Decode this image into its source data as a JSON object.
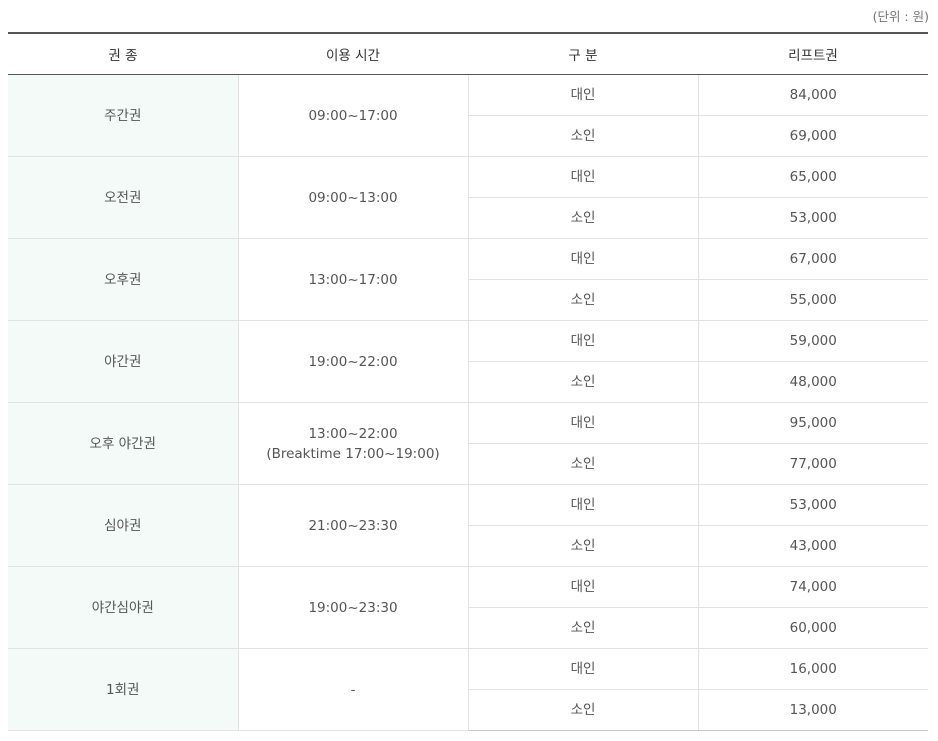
{
  "unit_note": "(단위 : 원)",
  "headers": [
    "권 종",
    "이용 시간",
    "구 분",
    "리프트권"
  ],
  "rows": [
    {
      "type": "주간권",
      "time": "09:00~17:00",
      "time2": "",
      "prices": [
        {
          "label": "대인",
          "price": "84,000"
        },
        {
          "label": "소인",
          "price": "69,000"
        }
      ]
    },
    {
      "type": "오전권",
      "time": "09:00~13:00",
      "time2": "",
      "prices": [
        {
          "label": "대인",
          "price": "65,000"
        },
        {
          "label": "소인",
          "price": "53,000"
        }
      ]
    },
    {
      "type": "오후권",
      "time": "13:00~17:00",
      "time2": "",
      "prices": [
        {
          "label": "대인",
          "price": "67,000"
        },
        {
          "label": "소인",
          "price": "55,000"
        }
      ]
    },
    {
      "type": "야간권",
      "time": "19:00~22:00",
      "time2": "",
      "prices": [
        {
          "label": "대인",
          "price": "59,000"
        },
        {
          "label": "소인",
          "price": "48,000"
        }
      ]
    },
    {
      "type": "오후 야간권",
      "time": "13:00~22:00",
      "time2": "(Breaktime 17:00~19:00)",
      "prices": [
        {
          "label": "대인",
          "price": "95,000"
        },
        {
          "label": "소인",
          "price": "77,000"
        }
      ]
    },
    {
      "type": "심야권",
      "time": "21:00~23:30",
      "time2": "",
      "prices": [
        {
          "label": "대인",
          "price": "53,000"
        },
        {
          "label": "소인",
          "price": "43,000"
        }
      ]
    },
    {
      "type": "야간심야권",
      "time": "19:00~23:30",
      "time2": "",
      "prices": [
        {
          "label": "대인",
          "price": "74,000"
        },
        {
          "label": "소인",
          "price": "60,000"
        }
      ]
    },
    {
      "type": "1회권",
      "time": "-",
      "time2": "",
      "prices": [
        {
          "label": "대인",
          "price": "16,000"
        },
        {
          "label": "소인",
          "price": "13,000"
        }
      ]
    }
  ]
}
